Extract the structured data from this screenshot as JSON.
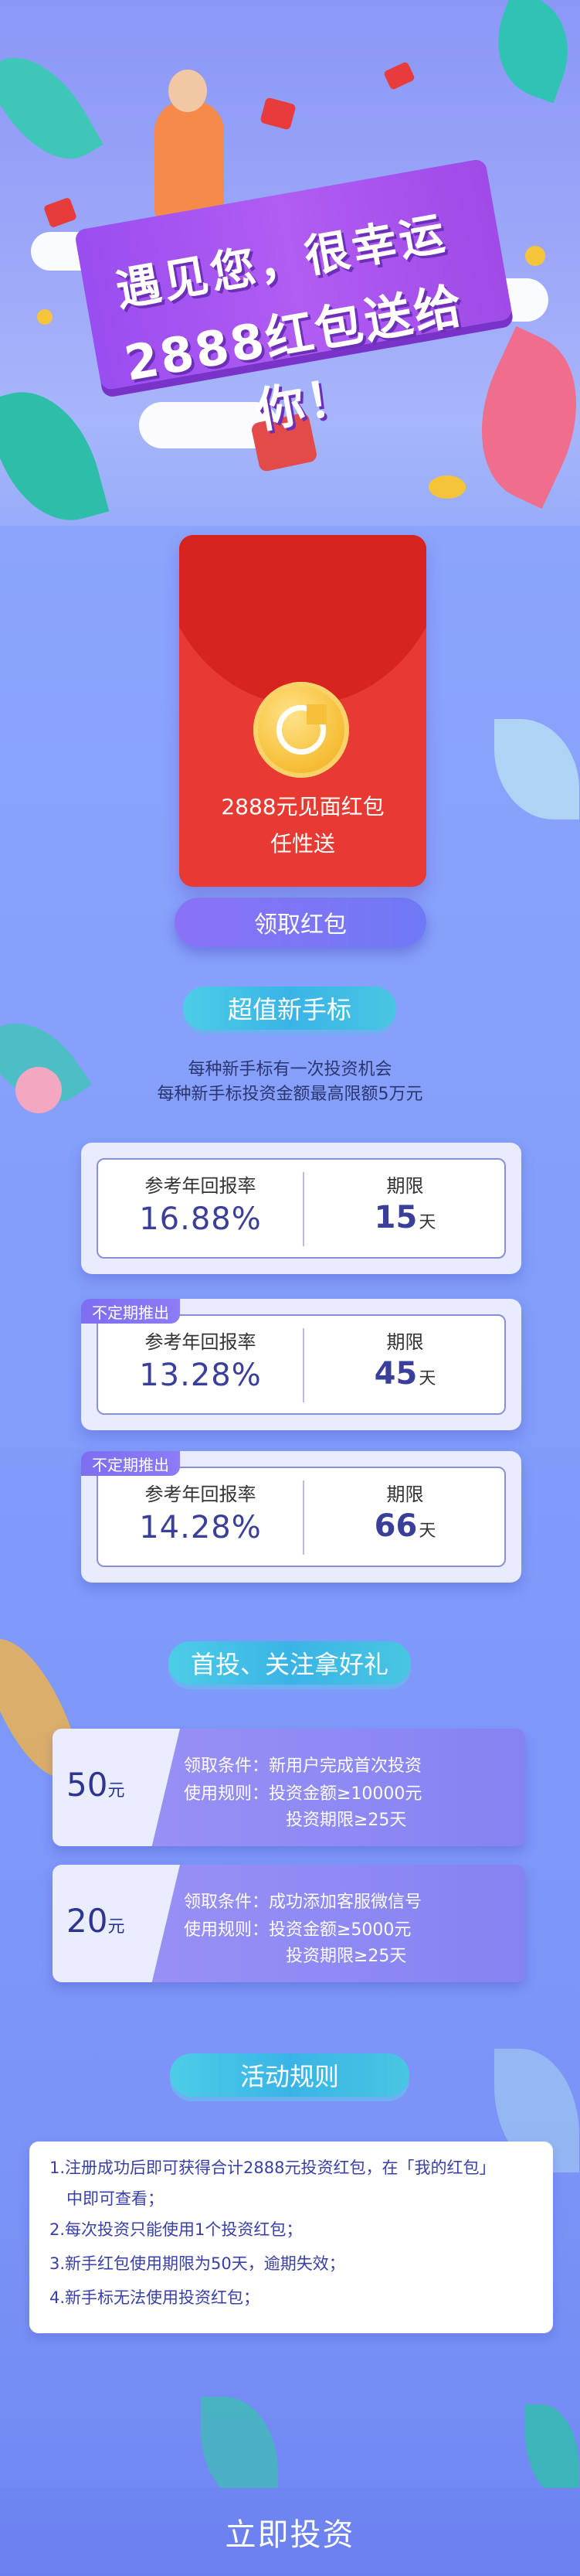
{
  "hero": {
    "line1": "遇见您，很幸运",
    "line2": "2888红包送给你！"
  },
  "packet": {
    "title": "2888元见面红包",
    "subtitle": "任性送",
    "claim_label": "领取红包"
  },
  "newbie": {
    "heading": "超值新手标",
    "intro1": "每种新手标有一次投资机会",
    "intro2": "每种新手标投资金额最高限额5万元",
    "plans": [
      {
        "badge": "",
        "rate_label": "参考年回报率",
        "rate": "16.88%",
        "term_label": "期限",
        "term": "15",
        "term_unit": "天"
      },
      {
        "badge": "不定期推出",
        "rate_label": "参考年回报率",
        "rate": "13.28%",
        "term_label": "期限",
        "term": "45",
        "term_unit": "天"
      },
      {
        "badge": "不定期推出",
        "rate_label": "参考年回报率",
        "rate": "14.28%",
        "term_label": "期限",
        "term": "66",
        "term_unit": "天"
      }
    ]
  },
  "first": {
    "heading": "首投、关注拿好礼",
    "coupons": [
      {
        "amount": "50",
        "unit": "元",
        "line1": "领取条件：新用户完成首次投资",
        "line2": "使用规则：投资金额≥10000元",
        "line3": "投资期限≥25天"
      },
      {
        "amount": "20",
        "unit": "元",
        "line1": "领取条件：成功添加客服微信号",
        "line2": "使用规则：投资金额≥5000元",
        "line3": "投资期限≥25天"
      }
    ]
  },
  "rules": {
    "heading": "活动规则",
    "items": [
      "1.注册成功后即可获得合计2888元投资红包，在「我的红包」",
      "中即可查看；",
      "2.每次投资只能使用1个投资红包；",
      "3.新手红包使用期限为50天，逾期失效；",
      "4.新手标无法使用投资红包；"
    ]
  },
  "cta": {
    "label": "立即投资"
  },
  "colors": {
    "accent": "#6f79f5",
    "red": "#e63a32",
    "heading": "#3ab4e6"
  }
}
